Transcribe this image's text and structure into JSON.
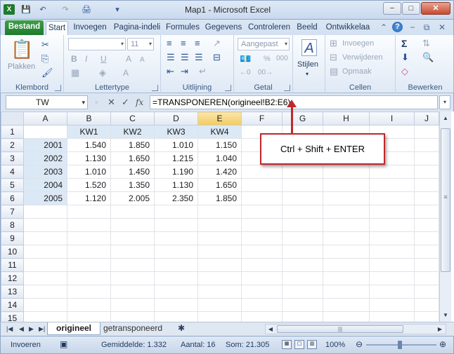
{
  "window": {
    "title": "Map1 - Microsoft Excel",
    "min": "−",
    "max": "□",
    "close": "✕"
  },
  "qat": {
    "save": "💾",
    "undo": "↶",
    "redo": "↷",
    "print": "🖨",
    "more": "▾"
  },
  "tabs": [
    "Bestand",
    "Start",
    "Invoegen",
    "Pagina-indeli",
    "Formules",
    "Gegevens",
    "Controleren",
    "Beeld",
    "Ontwikkelaa"
  ],
  "ribbon": {
    "clipboard": {
      "label": "Klembord",
      "paste": "Plakken"
    },
    "font": {
      "label": "Lettertype",
      "font_name": "",
      "font_size": "11",
      "bold": "B",
      "italic": "I",
      "underline": "U",
      "grow": "A",
      "shrink": "A",
      "color": "A"
    },
    "alignment": {
      "label": "Uitlijning"
    },
    "number": {
      "label": "Getal",
      "format": "Aangepast",
      "percent": "%",
      "thousands": "000"
    },
    "styles": {
      "label": "Stijlen"
    },
    "cells": {
      "label": "Cellen",
      "insert": "Invoegen",
      "delete": "Verwijderen",
      "format": "Opmaak"
    },
    "editing": {
      "label": "Bewerken",
      "sum": "Σ"
    }
  },
  "formula_bar": {
    "namebox": "TW",
    "cancel": "✕",
    "enter": "✓",
    "fx": "fx",
    "formula": "=TRANSPONEREN(origineel!B2:E6)"
  },
  "grid": {
    "columns": [
      "A",
      "B",
      "C",
      "D",
      "E",
      "F",
      "G",
      "H",
      "I",
      "J"
    ],
    "rows": [
      [
        "",
        "KW1",
        "KW2",
        "KW3",
        "KW4",
        "",
        "",
        "",
        "",
        ""
      ],
      [
        "2001",
        "1.540",
        "1.850",
        "1.010",
        "1.150",
        "",
        "",
        "",
        "",
        ""
      ],
      [
        "2002",
        "1.130",
        "1.650",
        "1.215",
        "1.040",
        "",
        "",
        "",
        "",
        ""
      ],
      [
        "2003",
        "1.010",
        "1.450",
        "1.190",
        "1.420",
        "",
        "",
        "",
        "",
        ""
      ],
      [
        "2004",
        "1.520",
        "1.350",
        "1.130",
        "1.650",
        "",
        "",
        "",
        "",
        ""
      ],
      [
        "2005",
        "1.120",
        "2.005",
        "2.350",
        "1.850",
        "",
        "",
        "",
        "",
        ""
      ],
      [
        "",
        "",
        "",
        "",
        "",
        "",
        "",
        "",
        "",
        ""
      ],
      [
        "",
        "",
        "",
        "",
        "",
        "",
        "",
        "",
        "",
        ""
      ],
      [
        "",
        "",
        "",
        "",
        "",
        "",
        "",
        "",
        "",
        ""
      ],
      [
        "",
        "",
        "",
        "",
        "",
        "",
        "",
        "",
        "",
        ""
      ],
      [
        "",
        "",
        "",
        "",
        "",
        "",
        "",
        "",
        "",
        ""
      ],
      [
        "",
        "",
        "",
        "",
        "",
        "",
        "",
        "",
        "",
        ""
      ],
      [
        "",
        "",
        "",
        "",
        "",
        "",
        "",
        "",
        "",
        ""
      ],
      [
        "",
        "",
        "",
        "",
        "",
        "",
        "",
        "",
        "",
        ""
      ],
      [
        "",
        "",
        "",
        "",
        "",
        "",
        "",
        "",
        "",
        ""
      ]
    ]
  },
  "callout": {
    "text": "Ctrl + Shift + ENTER"
  },
  "sheets": [
    "origineel",
    "getransponeerd"
  ],
  "statusbar": {
    "mode": "Invoeren",
    "average": "Gemiddelde:  1.332",
    "count": "Aantal: 16",
    "sum": "Som:  21.305",
    "zoom": "100%"
  },
  "colors": {
    "accent": "#2b579a",
    "file_tab": "#1f7a2d",
    "callout_border": "#c0282b",
    "selection": "#f3cb5c"
  }
}
